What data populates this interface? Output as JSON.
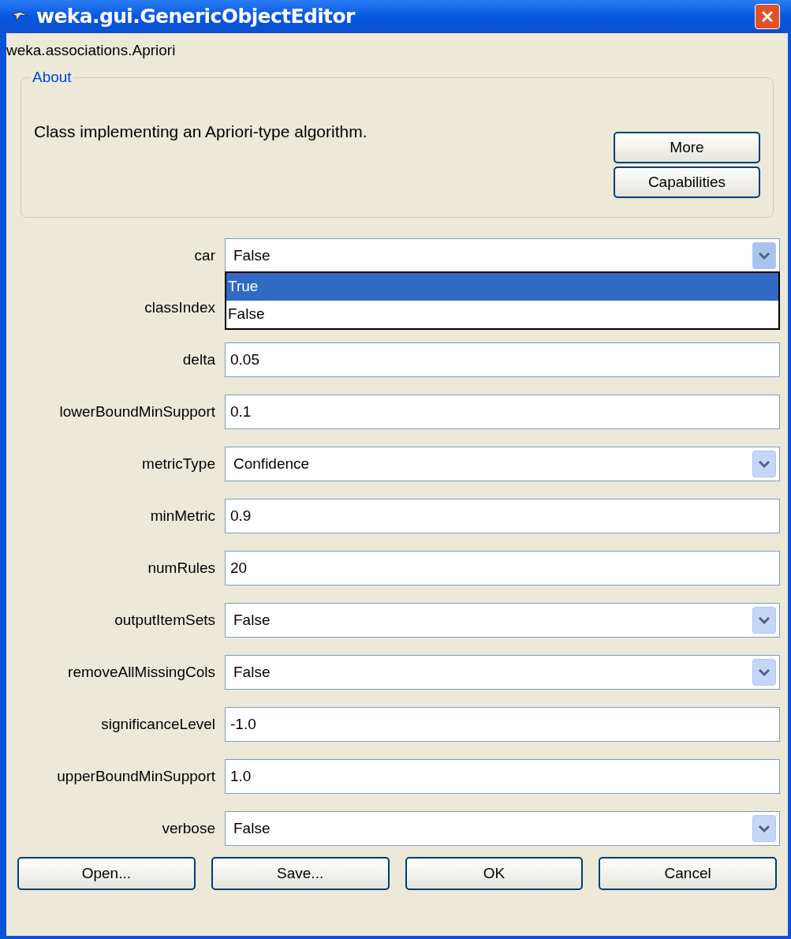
{
  "window": {
    "title": "weka.gui.GenericObjectEditor"
  },
  "class_name": "weka.associations.Apriori",
  "about": {
    "title": "About",
    "description": "Class implementing an Apriori-type algorithm.",
    "buttons": [
      "More",
      "Capabilities"
    ]
  },
  "properties": [
    {
      "label": "car",
      "kind": "dropdown",
      "value": "False",
      "expanded": true,
      "options": [
        {
          "label": "True",
          "highlighted": true
        },
        {
          "label": "False",
          "highlighted": false
        }
      ]
    },
    {
      "label": "classIndex",
      "kind": "covered"
    },
    {
      "label": "delta",
      "kind": "text",
      "value": "0.05"
    },
    {
      "label": "lowerBoundMinSupport",
      "kind": "text",
      "value": "0.1"
    },
    {
      "label": "metricType",
      "kind": "dropdown",
      "value": "Confidence",
      "expanded": false
    },
    {
      "label": "minMetric",
      "kind": "text",
      "value": "0.9"
    },
    {
      "label": "numRules",
      "kind": "text",
      "value": "20"
    },
    {
      "label": "outputItemSets",
      "kind": "dropdown",
      "value": "False",
      "expanded": false
    },
    {
      "label": "removeAllMissingCols",
      "kind": "dropdown",
      "value": "False",
      "expanded": false
    },
    {
      "label": "significanceLevel",
      "kind": "text",
      "value": "-1.0"
    },
    {
      "label": "upperBoundMinSupport",
      "kind": "text",
      "value": "1.0"
    },
    {
      "label": "verbose",
      "kind": "dropdown",
      "value": "False",
      "expanded": false
    }
  ],
  "buttons": [
    "Open...",
    "Save...",
    "OK",
    "Cancel"
  ]
}
